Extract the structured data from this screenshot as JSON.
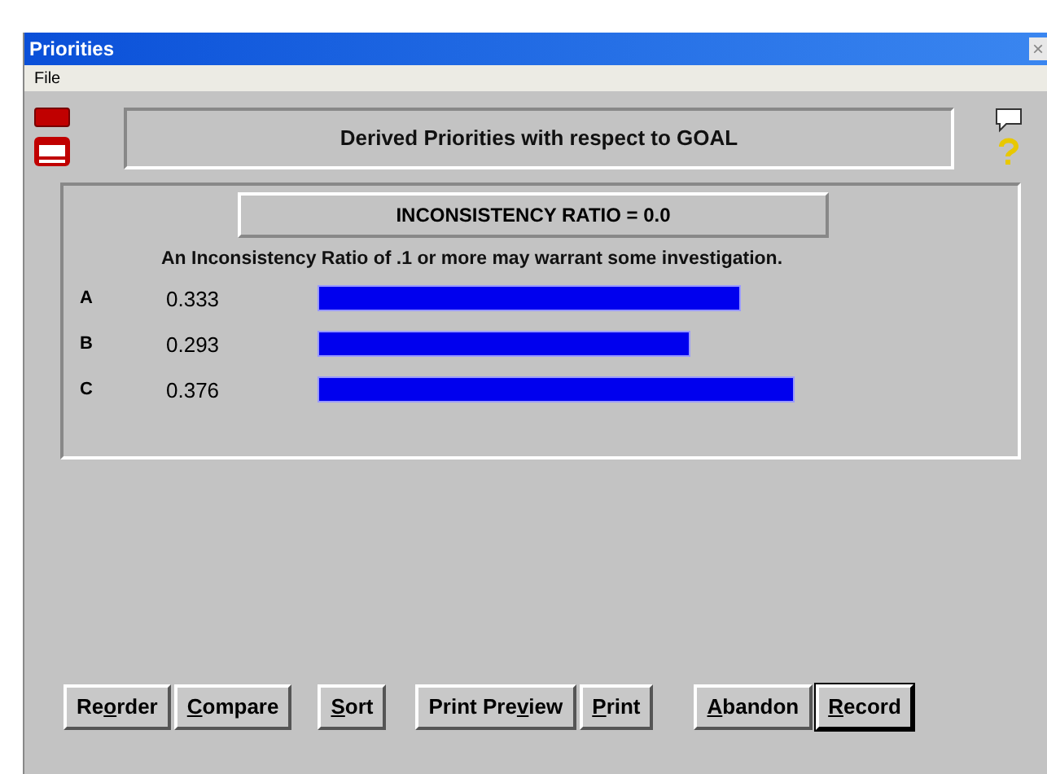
{
  "window": {
    "title": "Priorities",
    "close": "×"
  },
  "menu": [
    "File"
  ],
  "header": "Derived Priorities with respect to GOAL",
  "ratio": "INCONSISTENCY RATIO = 0.0",
  "note": "An Inconsistency Ratio of .1 or more may warrant some investigation.",
  "priorities": [
    {
      "label": "A",
      "value": "0.333"
    },
    {
      "label": "B",
      "value": "0.293"
    },
    {
      "label": "C",
      "value": "0.376"
    }
  ],
  "buttons": [
    {
      "before": "Re",
      "key": "o",
      "after": "rder",
      "default": false
    },
    {
      "key": "C",
      "after": "ompare",
      "default": false
    },
    {
      "key": "S",
      "after": "ort",
      "default": false
    },
    {
      "before": "Print Pre",
      "key": "v",
      "after": "iew",
      "default": false
    },
    {
      "key": "P",
      "after": "rint",
      "default": false
    },
    {
      "key": "A",
      "after": "bandon",
      "default": false
    },
    {
      "key": "R",
      "after": "ecord",
      "default": true
    }
  ]
}
